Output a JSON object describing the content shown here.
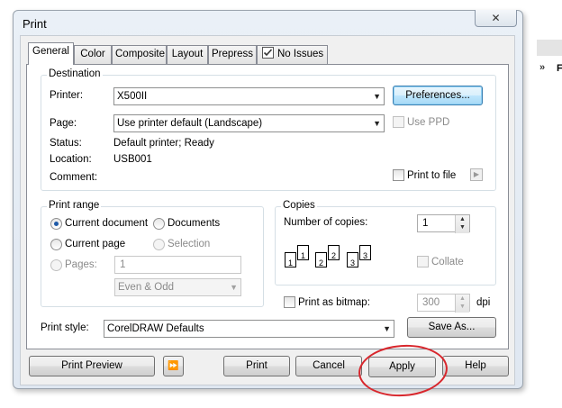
{
  "window": {
    "title": "Print",
    "close_glyph": "✕"
  },
  "right_side": {
    "chevron": "»",
    "letter": "F"
  },
  "tabs": [
    {
      "label": "General"
    },
    {
      "label": "Color"
    },
    {
      "label": "Composite"
    },
    {
      "label": "Layout"
    },
    {
      "label": "Prepress"
    },
    {
      "label": "No Issues",
      "icon": "checklist-icon"
    }
  ],
  "destination": {
    "group_label": "Destination",
    "printer_label": "Printer:",
    "printer_value": "X500II",
    "preferences_button": "Preferences...",
    "page_label": "Page:",
    "page_value": "Use printer default (Landscape)",
    "use_ppd_label": "Use PPD",
    "status_label": "Status:",
    "status_value": "Default printer; Ready",
    "location_label": "Location:",
    "location_value": "USB001",
    "comment_label": "Comment:",
    "print_to_file_label": "Print to file"
  },
  "print_range": {
    "group_label": "Print range",
    "current_document": "Current document",
    "documents": "Documents",
    "current_page": "Current page",
    "selection": "Selection",
    "pages_label": "Pages:",
    "pages_value": "1",
    "even_odd_value": "Even & Odd"
  },
  "copies": {
    "group_label": "Copies",
    "number_label": "Number of copies:",
    "number_value": "1",
    "collate_label": "Collate",
    "page_numbers": [
      "1",
      "1",
      "2",
      "2",
      "3",
      "3"
    ]
  },
  "bitmap": {
    "label": "Print as bitmap:",
    "dpi_value": "300",
    "dpi_unit": "dpi"
  },
  "print_style": {
    "label": "Print style:",
    "value": "CorelDRAW Defaults",
    "save_as_button": "Save As..."
  },
  "footer": {
    "print_preview": "Print Preview",
    "expand_glyph": "⏩",
    "print": "Print",
    "cancel": "Cancel",
    "apply": "Apply",
    "help": "Help"
  },
  "colors": {
    "annotation": "#d8262c",
    "focus_border": "#3c7fb1",
    "radio_dot": "#1f5aa8"
  }
}
